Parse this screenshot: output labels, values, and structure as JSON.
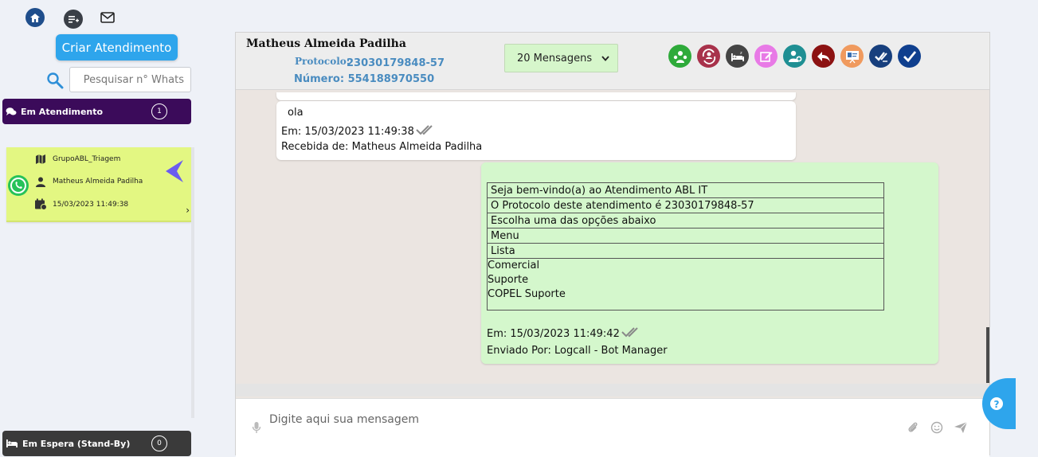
{
  "toolbar": {
    "home_icon": "home-icon",
    "list_icon": "list-add-icon",
    "mail_icon": "mail-icon"
  },
  "sidebar": {
    "create_button": "Criar Atendimento",
    "search_placeholder": "Pesquisar n° Whats",
    "in_service": {
      "label": "Em Atendimento",
      "count": "1"
    },
    "standby": {
      "label": "Em Espera (Stand-By)",
      "count": "0"
    },
    "chat_card": {
      "group": "GrupoABL_Triagem",
      "contact": "Matheus Almeida Padilha",
      "datetime": "15/03/2023 11:49:38"
    }
  },
  "header": {
    "contact_name": "Matheus Almeida Padilha",
    "protocol_label": "Protocolo:",
    "protocol_value": "23030179848-57",
    "number_text": "Número: 554188970550",
    "messages_select": "20 Mensagens"
  },
  "messages": {
    "incoming": {
      "text": "ola",
      "date": "Em: 15/03/2023 11:49:38",
      "from": "Recebida de: Matheus Almeida  Padilha"
    },
    "outgoing": {
      "rows": [
        "Seja bem-vindo(a) ao Atendimento ABL IT",
        "O Protocolo deste atendimento é 23030179848-57",
        "Escolha uma das opções abaixo",
        " Menu",
        " Lista"
      ],
      "options": [
        "Comercial",
        "Suporte",
        "COPEL Suporte"
      ],
      "date": "Em: 15/03/2023 11:49:42",
      "sender": "Enviado Por: Logcall - Bot Manager"
    }
  },
  "composer": {
    "placeholder": "Digite aqui sua mensagem"
  },
  "colors": {
    "accent": "#2ea5ec",
    "in_service_bar": "#3b0b5a",
    "card_bg": "#e3f782",
    "outgoing_bubble": "#d4f7cc"
  }
}
